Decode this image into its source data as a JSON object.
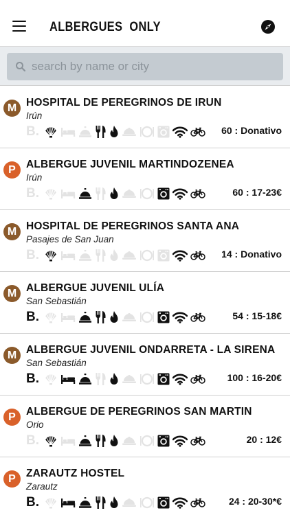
{
  "header": {
    "title": "ALBERGUES  ONLY",
    "menu_icon": "hamburger-menu-icon",
    "compass_icon": "compass-icon"
  },
  "search": {
    "placeholder": "search by name or city",
    "value": "",
    "icon": "search-icon"
  },
  "colors": {
    "municipal": "#8b5a2b",
    "private": "#d9612a",
    "active_icon": "#111111",
    "inactive_icon": "#e3e3e3"
  },
  "amenity_icons": [
    "breakfast",
    "shell",
    "bed",
    "reception-bell",
    "cutlery",
    "fire",
    "dinner-dish",
    "plate",
    "washing-machine",
    "wifi",
    "bicycle"
  ],
  "albergues": [
    {
      "type": "M",
      "name": "HOSPITAL DE PEREGRINOS DE IRUN",
      "city": "Irún",
      "beds_price": "60 : Donativo",
      "amenities": {
        "breakfast": false,
        "shell": true,
        "bed": false,
        "reception-bell": false,
        "cutlery": true,
        "fire": true,
        "dinner-dish": false,
        "plate": false,
        "washing-machine": false,
        "wifi": true,
        "bicycle": true
      }
    },
    {
      "type": "P",
      "name": "ALBERGUE JUVENIL MARTINDOZENEA",
      "city": "Irún",
      "beds_price": "60 : 17-23€",
      "amenities": {
        "breakfast": false,
        "shell": false,
        "bed": false,
        "reception-bell": true,
        "cutlery": false,
        "fire": true,
        "dinner-dish": false,
        "plate": false,
        "washing-machine": true,
        "wifi": true,
        "bicycle": true
      }
    },
    {
      "type": "M",
      "name": "HOSPITAL DE PEREGRINOS SANTA ANA",
      "city": "Pasajes de San Juan",
      "beds_price": "14 : Donativo",
      "amenities": {
        "breakfast": false,
        "shell": true,
        "bed": false,
        "reception-bell": false,
        "cutlery": false,
        "fire": false,
        "dinner-dish": false,
        "plate": false,
        "washing-machine": false,
        "wifi": true,
        "bicycle": true
      }
    },
    {
      "type": "M",
      "name": "ALBERGUE JUVENIL ULÍA",
      "city": "San Sebastián",
      "beds_price": "54 : 15-18€",
      "amenities": {
        "breakfast": true,
        "shell": false,
        "bed": false,
        "reception-bell": true,
        "cutlery": true,
        "fire": true,
        "dinner-dish": false,
        "plate": false,
        "washing-machine": true,
        "wifi": true,
        "bicycle": true
      }
    },
    {
      "type": "M",
      "name": "ALBERGUE JUVENIL ONDARRETA - LA SIRENA",
      "city": "San Sebastián",
      "beds_price": "100 : 16-20€",
      "amenities": {
        "breakfast": true,
        "shell": false,
        "bed": true,
        "reception-bell": true,
        "cutlery": false,
        "fire": true,
        "dinner-dish": false,
        "plate": false,
        "washing-machine": true,
        "wifi": true,
        "bicycle": true
      }
    },
    {
      "type": "P",
      "name": "ALBERGUE DE PEREGRINOS SAN MARTIN",
      "city": "Orio",
      "beds_price": "20 : 12€",
      "amenities": {
        "breakfast": false,
        "shell": true,
        "bed": false,
        "reception-bell": true,
        "cutlery": true,
        "fire": true,
        "dinner-dish": false,
        "plate": false,
        "washing-machine": true,
        "wifi": true,
        "bicycle": true
      }
    },
    {
      "type": "P",
      "name": "ZARAUTZ HOSTEL",
      "city": "Zarautz",
      "beds_price": "24 : 20-30*€",
      "amenities": {
        "breakfast": true,
        "shell": false,
        "bed": true,
        "reception-bell": true,
        "cutlery": true,
        "fire": true,
        "dinner-dish": false,
        "plate": false,
        "washing-machine": true,
        "wifi": true,
        "bicycle": true
      }
    }
  ]
}
